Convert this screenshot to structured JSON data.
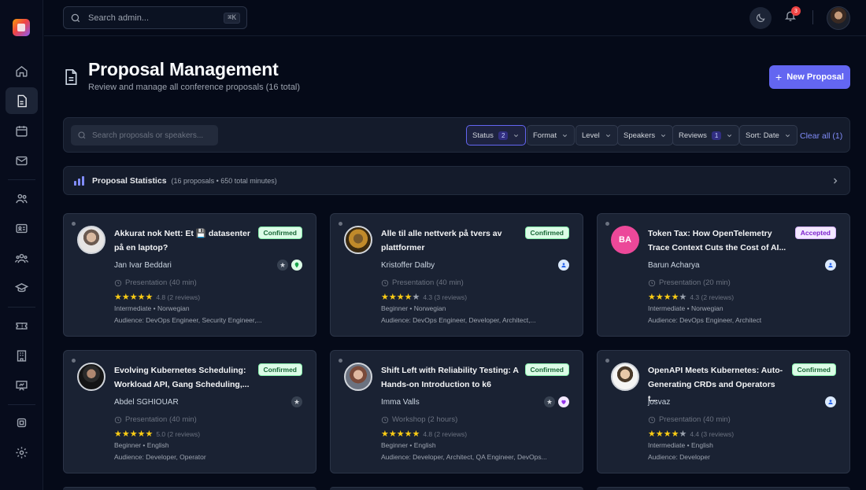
{
  "topbar": {
    "search_placeholder": "Search admin...",
    "search_shortcut": "⌘K",
    "notification_count": "3"
  },
  "header": {
    "title": "Proposal Management",
    "subtitle": "Review and manage all conference proposals (16 total)",
    "new_button_label": "New Proposal"
  },
  "filters": {
    "search_placeholder": "Search proposals or speakers...",
    "status_label": "Status",
    "status_count": "2",
    "format_label": "Format",
    "level_label": "Level",
    "speakers_label": "Speakers",
    "reviews_label": "Reviews",
    "reviews_count": "1",
    "sort_label": "Sort: Date",
    "clear_all": "Clear all (1)"
  },
  "stats": {
    "title": "Proposal Statistics",
    "subtitle": "(16 proposals • 650 total minutes)"
  },
  "proposals": [
    {
      "title": "Akkurat nok Nett: Et 💾 datasenter på en laptop?",
      "status": "Confirmed",
      "speaker": "Jan Ivar Beddari",
      "format": "Presentation (40 min)",
      "rating": "4.8 (2 reviews)",
      "level": "Intermediate • Norwegian",
      "audience": "Audience: DevOps Engineer, Security Engineer,..."
    },
    {
      "title": "Alle til alle nettverk på tvers av plattformer",
      "status": "Confirmed",
      "speaker": "Kristoffer Dalby",
      "format": "Presentation (40 min)",
      "rating": "4.3 (3 reviews)",
      "level": "Beginner • Norwegian",
      "audience": "Audience: DevOps Engineer, Developer, Architect,..."
    },
    {
      "title": "Token Tax: How OpenTelemetry Trace Context Cuts the Cost of AI...",
      "status": "Accepted",
      "speaker": "Barun Acharya",
      "initials": "BA",
      "format": "Presentation (20 min)",
      "rating": "4.3 (2 reviews)",
      "level": "Intermediate • Norwegian",
      "audience": "Audience: DevOps Engineer, Architect"
    },
    {
      "title": "Evolving Kubernetes Scheduling: Workload API, Gang Scheduling,...",
      "status": "Confirmed",
      "speaker": "Abdel SGHIOUAR",
      "format": "Presentation (40 min)",
      "rating": "5.0 (2 reviews)",
      "level": "Beginner • English",
      "audience": "Audience: Developer, Operator"
    },
    {
      "title": "Shift Left with Reliability Testing: A Hands-on Introduction to k6",
      "status": "Confirmed",
      "speaker": "Imma Valls",
      "format": "Workshop (2 hours)",
      "rating": "4.8 (2 reviews)",
      "level": "Beginner • English",
      "audience": "Audience: Developer, Architect, QA Engineer, DevOps..."
    },
    {
      "title": "OpenAPI Meets Kubernetes: Auto-Generating CRDs and Operators t...",
      "status": "Confirmed",
      "speaker": "josvaz",
      "format": "Presentation (40 min)",
      "rating": "4.4 (3 reviews)",
      "level": "Intermediate • English",
      "audience": "Audience: Developer"
    }
  ],
  "colors": {
    "accent": "#6366f1",
    "confirmed_bg": "#dcfce7",
    "accepted_bg": "#f3e8ff",
    "star": "#facc15"
  }
}
